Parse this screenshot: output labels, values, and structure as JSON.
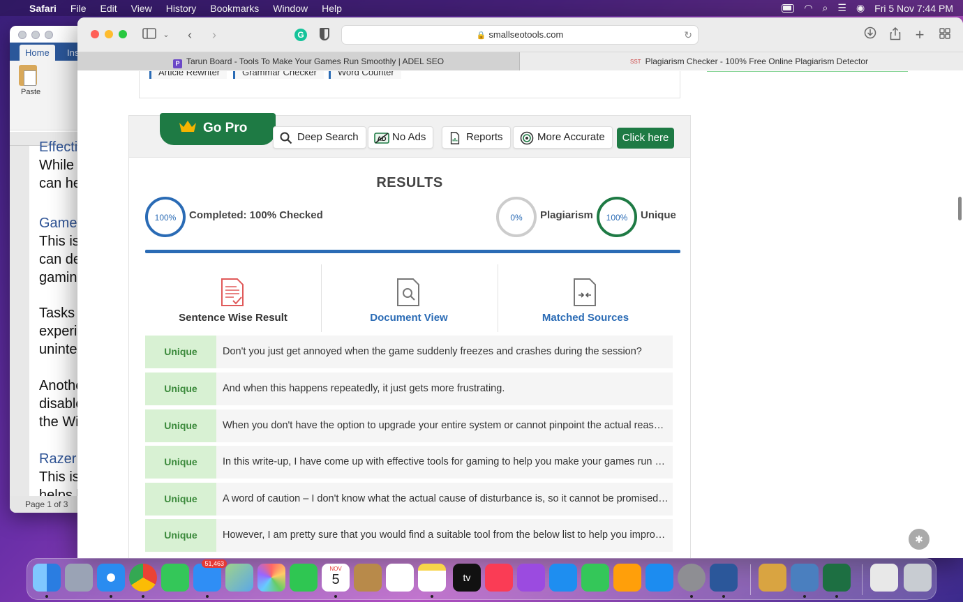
{
  "menubar": {
    "app": "Safari",
    "items": [
      "File",
      "Edit",
      "View",
      "History",
      "Bookmarks",
      "Window",
      "Help"
    ],
    "clock": "Fri 5 Nov  7:44 PM"
  },
  "word": {
    "tab_home": "Home",
    "tab_insert": "Ins",
    "paste": "Paste",
    "status": "Page 1 of 3",
    "lines": [
      "Effecti",
      "While",
      "can he",
      "Game",
      "This is",
      "can de",
      "gaming",
      "Tasks l",
      "experi",
      "uninte",
      "Anothe",
      "disable",
      "the Wi",
      "Razer C",
      "This is",
      "helps h"
    ]
  },
  "browser": {
    "url": "smallseotools.com",
    "tabs": [
      {
        "label": "Tarun Board - Tools To Make Your Games Run Smoothly | ADEL SEO",
        "fav": "P"
      },
      {
        "label": "Plagiarism Checker - 100% Free Online Plagiarism Detector",
        "fav": "SST"
      }
    ]
  },
  "page": {
    "quick_links": [
      "Article Rewriter",
      "Grammar Checker",
      "Word Counter"
    ],
    "go_pro": "Go Pro",
    "features": [
      "Deep Search",
      "No Ads",
      "Reports",
      "More Accurate"
    ],
    "click_here": "Click here",
    "results_title": "RESULTS",
    "completed_pct": "100%",
    "completed_label": "Completed: 100% Checked",
    "plagiarism_pct": "0%",
    "plagiarism_label": "Plagiarism",
    "unique_pct": "100%",
    "unique_label": "Unique",
    "views": [
      "Sentence Wise Result",
      "Document View",
      "Matched Sources"
    ],
    "rows": [
      {
        "status": "Unique",
        "text": "Don't you just get annoyed when the game suddenly freezes and crashes during the session?"
      },
      {
        "status": "Unique",
        "text": "And when this happens repeatedly, it just gets more frustrating."
      },
      {
        "status": "Unique",
        "text": "When you don't have the option to upgrade your entire system or cannot pinpoint the actual reason fo..."
      },
      {
        "status": "Unique",
        "text": "In this write-up, I have come up with effective tools for gaming to help you make your games run smo..."
      },
      {
        "status": "Unique",
        "text": "A word of caution – I don't know what the actual cause of disturbance is, so it cannot be promised wh..."
      },
      {
        "status": "Unique",
        "text": "However, I am pretty sure that you would find a suitable tool from the below list to help you improve y..."
      }
    ]
  },
  "dock": {
    "mail_badge": "51,463",
    "cal_month": "NOV",
    "cal_day": "5",
    "tv_label": "tv"
  },
  "colors": {
    "accent_green": "#1e7a44",
    "accent_blue": "#2a6bb5",
    "unique_badge_bg": "#d8f1d3"
  }
}
